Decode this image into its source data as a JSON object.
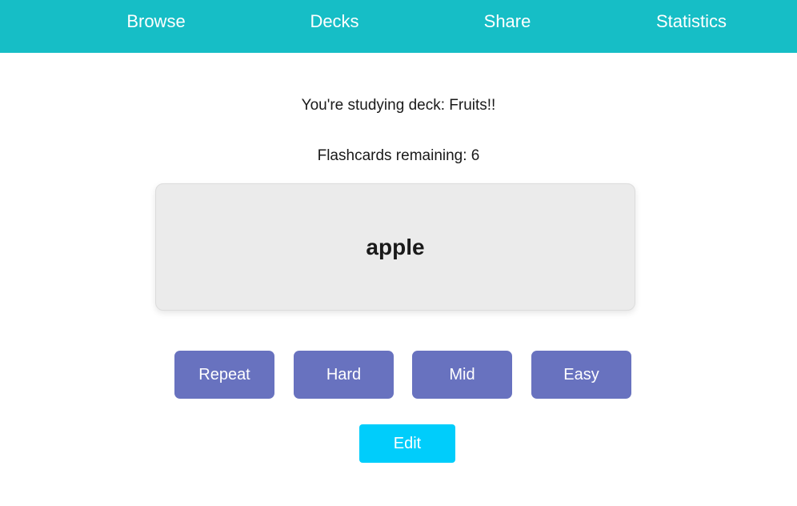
{
  "nav": {
    "items": [
      {
        "label": "Browse"
      },
      {
        "label": "Decks"
      },
      {
        "label": "Share"
      },
      {
        "label": "Statistics"
      }
    ]
  },
  "study": {
    "deck_text": "You're studying deck: Fruits!!",
    "remaining_text": "Flashcards remaining: 6"
  },
  "card": {
    "word": "apple"
  },
  "rating_buttons": [
    {
      "label": "Repeat"
    },
    {
      "label": "Hard"
    },
    {
      "label": "Mid"
    },
    {
      "label": "Easy"
    }
  ],
  "edit_button": {
    "label": "Edit"
  },
  "colors": {
    "nav_background": "#16bec6",
    "rating_button": "#6872bf",
    "edit_button": "#00cdfb",
    "card_background": "#ebebeb"
  }
}
